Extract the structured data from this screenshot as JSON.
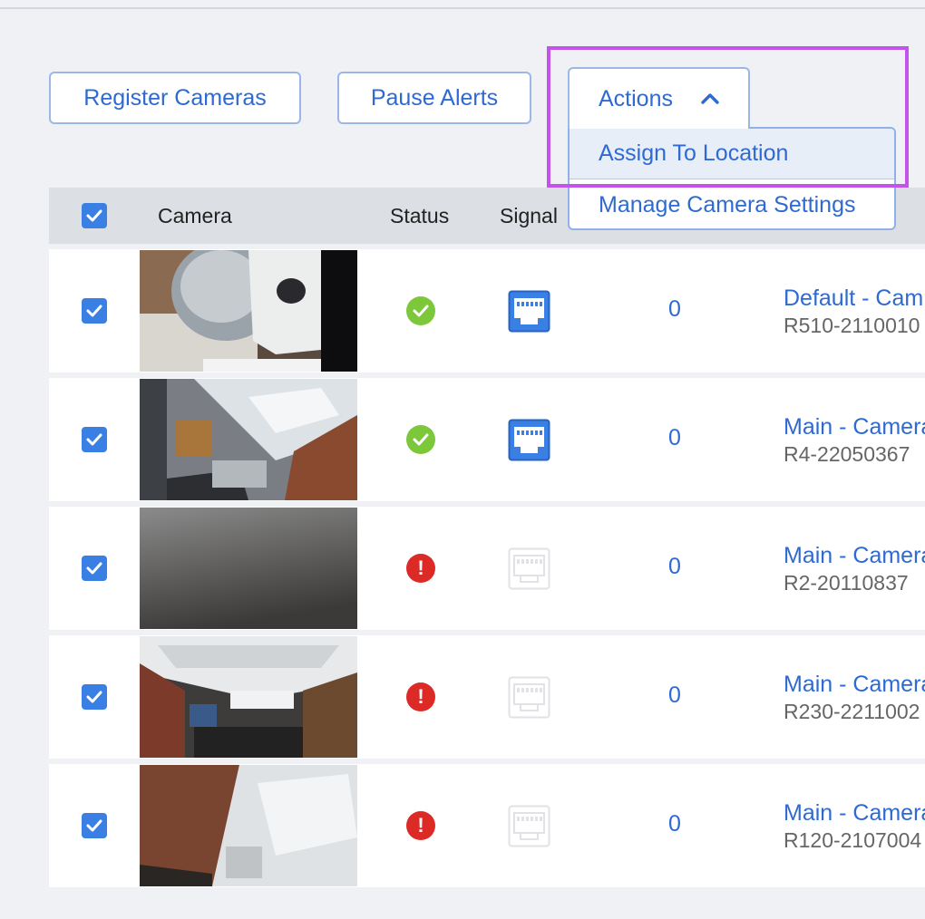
{
  "toolbar": {
    "register_label": "Register Cameras",
    "pause_label": "Pause Alerts",
    "actions_label": "Actions"
  },
  "actions_menu": {
    "items": [
      {
        "label": "Assign To Location"
      },
      {
        "label": "Manage Camera Settings"
      }
    ]
  },
  "table": {
    "headers": {
      "camera": "Camera",
      "status": "Status",
      "signal": "Signal"
    },
    "rows": [
      {
        "checked": true,
        "status": "ok",
        "signal": "wired-connected",
        "count": "0",
        "name": "Default - Cam",
        "serial": "R510-2110010"
      },
      {
        "checked": true,
        "status": "ok",
        "signal": "wired-connected",
        "count": "0",
        "name": "Main - Camera",
        "serial": "R4-22050367"
      },
      {
        "checked": true,
        "status": "error",
        "signal": "wired-disconnected",
        "count": "0",
        "name": "Main - Camera",
        "serial": "R2-20110837"
      },
      {
        "checked": true,
        "status": "error",
        "signal": "wired-disconnected",
        "count": "0",
        "name": "Main - Camera",
        "serial": "R230-2211002"
      },
      {
        "checked": true,
        "status": "error",
        "signal": "wired-disconnected",
        "count": "0",
        "name": "Main - Camera",
        "serial": "R120-2107004"
      }
    ]
  },
  "colors": {
    "accent": "#2e6ad1",
    "checkbox": "#3a7fe4",
    "ok": "#7cc83a",
    "error": "#dc2b26",
    "highlight": "#c453e9"
  }
}
